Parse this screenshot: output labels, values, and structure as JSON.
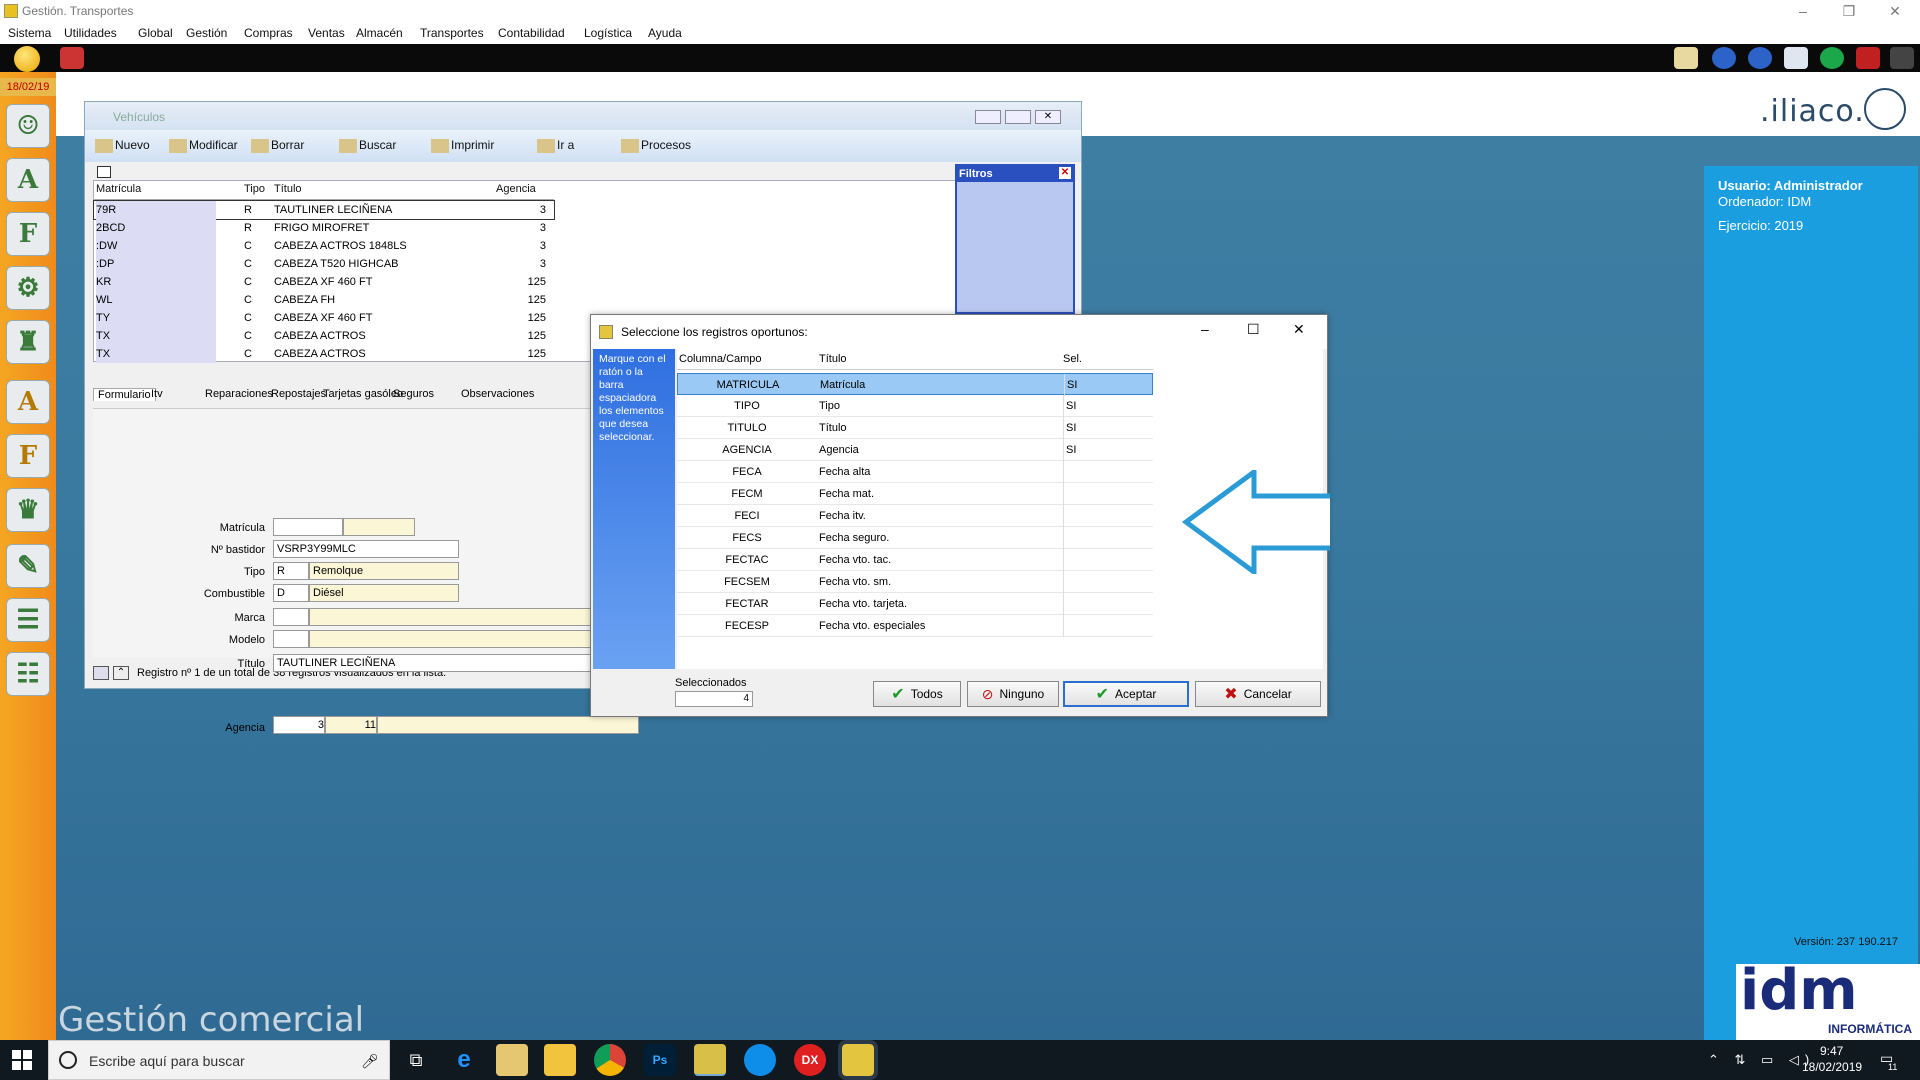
{
  "app": {
    "title": "Gestión. Transportes"
  },
  "menu": [
    "Sistema",
    "Utilidades",
    "Global",
    "Gestión",
    "Compras",
    "Ventas",
    "Almacén",
    "Transportes",
    "Contabilidad",
    "Logística",
    "Ayuda"
  ],
  "date": "18/02/19",
  "brand": {
    "logo": ".iliaco.",
    "footer": "Gestión comercial",
    "idm": "idm",
    "idm_sub": "INFORMÁTICA"
  },
  "info": {
    "user": "Usuario: Administrador",
    "computer": "Ordenador:  IDM",
    "year": "Ejercicio: 2019",
    "version": "Versión: 237 190.217"
  },
  "vehiculos": {
    "title": "Vehículos",
    "tools": [
      "Nuevo",
      "Modificar",
      "Borrar",
      "Buscar",
      "Imprimir",
      "Ir a",
      "Procesos"
    ],
    "columns": [
      "Matrícula",
      "Tipo",
      "Título",
      "Agencia"
    ],
    "rows": [
      [
        "79R",
        "R",
        "TAUTLINER LECIÑENA",
        "3"
      ],
      [
        "2BCD",
        "R",
        "FRIGO MIROFRET",
        "3"
      ],
      [
        ":DW",
        "C",
        "CABEZA ACTROS 1848LS",
        "3"
      ],
      [
        ":DP",
        "C",
        "CABEZA T520 HIGHCAB",
        "3"
      ],
      [
        "KR",
        "C",
        "CABEZA XF 460 FT",
        "125"
      ],
      [
        "WL",
        "C",
        "CABEZA FH",
        "125"
      ],
      [
        "TY",
        "C",
        "CABEZA XF 460 FT",
        "125"
      ],
      [
        "TX",
        "C",
        "CABEZA ACTROS",
        "125"
      ],
      [
        "TX",
        "C",
        "CABEZA ACTROS",
        "125"
      ]
    ],
    "filters_title": "Filtros",
    "tabs": [
      "Formulario",
      "Itv",
      "Reparaciones",
      "Repostajes",
      "Tarjetas gasóleo",
      "Seguros",
      "Observaciones"
    ],
    "form": {
      "matricula_label": "Matrícula",
      "bastidor_label": "Nº bastidor",
      "bastidor": "VSRP3Y99MLC",
      "tipo_label": "Tipo",
      "tipo_code": "R",
      "tipo_name": "Remolque",
      "comb_label": "Combustible",
      "comb_code": "D",
      "comb_name": "Diésel",
      "marca_label": "Marca",
      "modelo_label": "Modelo",
      "titulo_label": "Título",
      "titulo": "TAUTLINER LECIÑENA",
      "agencia_label": "Agencia",
      "agencia_a": "3",
      "agencia_b": "11"
    },
    "status": "Registro nº 1 de un total de 38 registros visualizados en la lista."
  },
  "dialog": {
    "title": "Seleccione los registros oportunos:",
    "hint": "Marque con el ratón o la barra espaciadora los elementos que desea seleccionar.",
    "columns": [
      "Columna/Campo",
      "Título",
      "Sel."
    ],
    "rows": [
      [
        "MATRICULA",
        "Matrícula",
        "SI"
      ],
      [
        "TIPO",
        "Tipo",
        "SI"
      ],
      [
        "TITULO",
        "Título",
        "SI"
      ],
      [
        "AGENCIA",
        "Agencia",
        "SI"
      ],
      [
        "FECA",
        "Fecha alta",
        ""
      ],
      [
        "FECM",
        "Fecha mat.",
        ""
      ],
      [
        "FECI",
        "Fecha itv.",
        ""
      ],
      [
        "FECS",
        "Fecha seguro.",
        ""
      ],
      [
        "FECTAC",
        "Fecha vto. tac.",
        ""
      ],
      [
        "FECSEM",
        "Fecha vto. sm.",
        ""
      ],
      [
        "FECTAR",
        "Fecha vto. tarjeta.",
        ""
      ],
      [
        "FECESP",
        "Fecha vto. especiales",
        ""
      ]
    ],
    "selected_label": "Seleccionados",
    "selected_count": "4",
    "btn_all": "Todos",
    "btn_none": "Ninguno",
    "btn_ok": "Aceptar",
    "btn_cancel": "Cancelar"
  },
  "taskbar": {
    "search": "Escribe aquí para buscar",
    "time": "9:47",
    "date": "18/02/2019",
    "notif": "11"
  }
}
